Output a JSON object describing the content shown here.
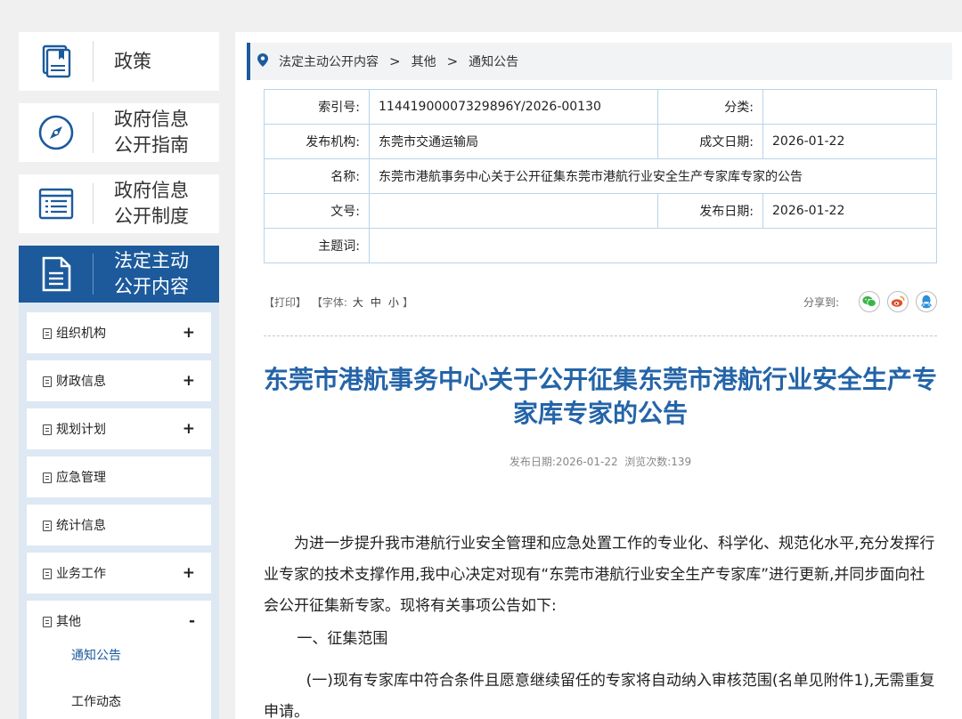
{
  "sidebar": {
    "categories": [
      {
        "title": "政策",
        "icon": "book-icon"
      },
      {
        "title": "政府信息\n公开指南",
        "icon": "compass-icon"
      },
      {
        "title": "政府信息\n公开制度",
        "icon": "list-icon"
      },
      {
        "title": "法定主动\n公开内容",
        "icon": "document-icon"
      }
    ],
    "items": [
      {
        "label": "组织机构",
        "toggle": "+"
      },
      {
        "label": "财政信息",
        "toggle": "+"
      },
      {
        "label": "规划计划",
        "toggle": "+"
      },
      {
        "label": "应急管理",
        "toggle": ""
      },
      {
        "label": "统计信息",
        "toggle": ""
      },
      {
        "label": "业务工作",
        "toggle": "+"
      },
      {
        "label": "其他",
        "toggle": "-"
      }
    ],
    "children": [
      "通知公告",
      "工作动态"
    ]
  },
  "breadcrumb": {
    "items": [
      "法定主动公开内容",
      "其他",
      "通知公告"
    ],
    "separator": ">"
  },
  "meta": {
    "index_label": "索引号:",
    "index_value": "11441900007329896Y/2026-00130",
    "category_label": "分类:",
    "category_value": "",
    "publisher_label": "发布机构:",
    "publisher_value": "东莞市交通运输局",
    "created_label": "成文日期:",
    "created_value": "2026-01-22",
    "name_label": "名称:",
    "name_value": "东莞市港航事务中心关于公开征集东莞市港航行业安全生产专家库专家的公告",
    "docno_label": "文号:",
    "docno_value": "",
    "published_label": "发布日期:",
    "published_value": "2026-01-22",
    "keywords_label": "主题词:",
    "keywords_value": ""
  },
  "tools": {
    "print": "【打印】",
    "font_prefix": "【字体:",
    "font_large": "大",
    "font_medium": "中",
    "font_small": "小",
    "font_suffix": "】",
    "share_label": "分享到:"
  },
  "article": {
    "title": "东莞市港航事务中心关于公开征集东莞市港航行业安全生产专家库专家的公告",
    "pub_info": "发布日期:2026-01-22  浏览次数:139",
    "para1": "为进一步提升我市港航行业安全管理和应急处置工作的专业化、科学化、规范化水平,充分发挥行业专家的技术支撑作用,我中心决定对现有“东莞市港航行业安全生产专家库”进行更新,并同步面向社会公开征集新专家。现将有关事项公告如下:",
    "section1": "一、征集范围",
    "item1": "(一)现有专家库中符合条件且愿意继续留任的专家将自动纳入审核范围(名单见附件1),无需重复申请。"
  },
  "colors": {
    "brand_blue": "#1c5a9c",
    "title_blue": "#2464a8",
    "wechat": "#3bb54a",
    "weibo": "#e6502a",
    "qq": "#2d8fd8"
  }
}
